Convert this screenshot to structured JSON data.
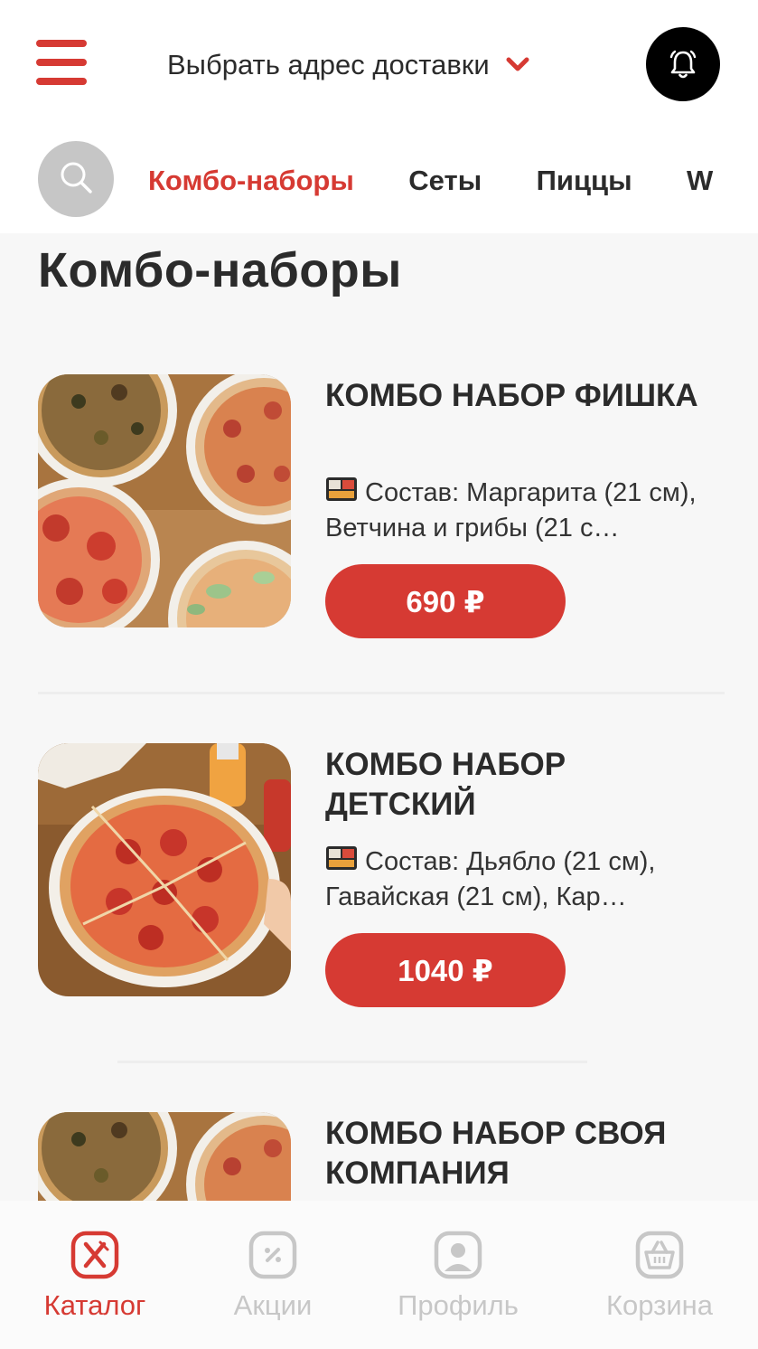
{
  "header": {
    "address_label": "Выбрать адрес доставки"
  },
  "categories": [
    {
      "label": "Комбо-наборы",
      "active": true
    },
    {
      "label": "Сеты",
      "active": false
    },
    {
      "label": "Пиццы",
      "active": false
    },
    {
      "label": "W",
      "active": false
    }
  ],
  "section_title": "Комбо-наборы",
  "products": [
    {
      "name": "КОМБО НАБОР ФИШКА",
      "description": "Состав: Маргарита (21 см), Ветчина и грибы (21 с…",
      "price": "690 ₽"
    },
    {
      "name": "КОМБО НАБОР ДЕТСКИЙ",
      "description": "Состав: Дьябло (21 см), Гавайская (21 см), Кар…",
      "price": "1040 ₽"
    },
    {
      "name": "КОМБО НАБОР СВОЯ КОМПАНИЯ",
      "description": "",
      "price": ""
    }
  ],
  "bottom_nav": [
    {
      "label": "Каталог",
      "icon": "catalog-icon",
      "active": true
    },
    {
      "label": "Акции",
      "icon": "promo-icon",
      "active": false
    },
    {
      "label": "Профиль",
      "icon": "profile-icon",
      "active": false
    },
    {
      "label": "Корзина",
      "icon": "cart-icon",
      "active": false
    }
  ],
  "colors": {
    "accent": "#d63a33",
    "background": "#f7f7f7",
    "inactive": "#c7c7c7"
  }
}
